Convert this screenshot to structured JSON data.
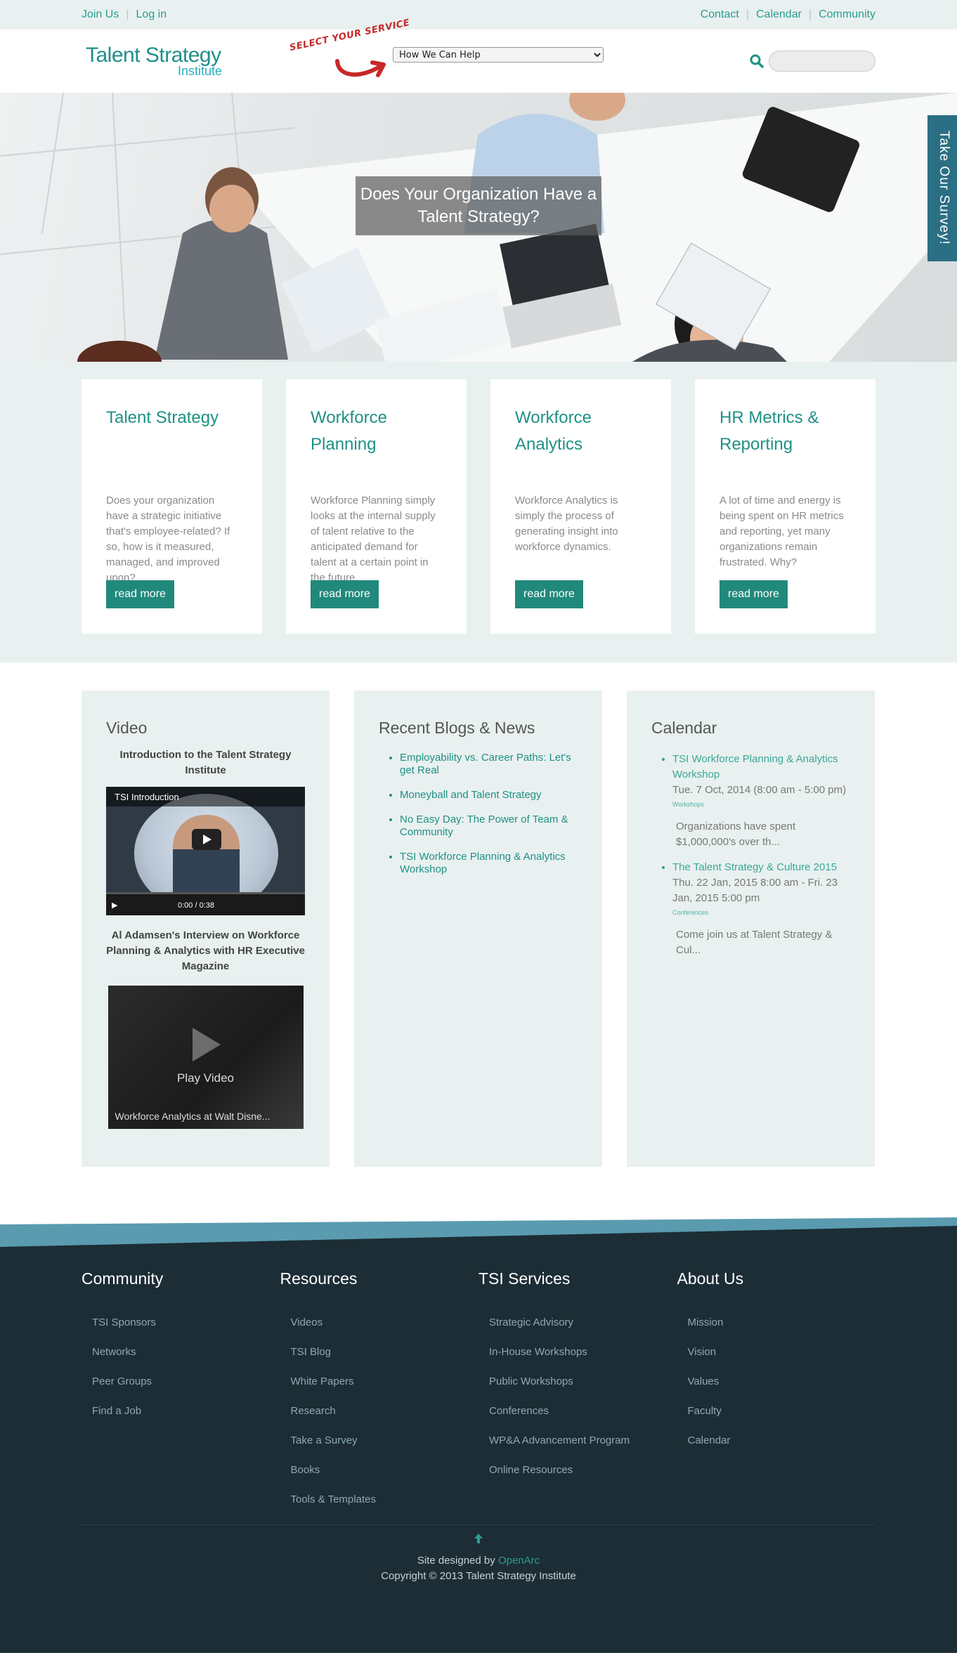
{
  "topbar": {
    "left_links": [
      "Join Us",
      "Log in"
    ],
    "right_links": [
      "Contact",
      "Calendar",
      "Community"
    ]
  },
  "header": {
    "logo_line1": "Talent Strategy",
    "logo_line2": "Institute",
    "select_service_label": "SELECT YOUR SERVICE",
    "service_select_value": "How We Can Help",
    "search_placeholder": ""
  },
  "hero": {
    "caption": "Does Your Organization Have a Talent Strategy?",
    "survey_tab": "Take Our Survey!"
  },
  "services": [
    {
      "title": "Talent Strategy",
      "text": "Does your organization have a strategic initiative that's employee-related?  If so, how is it measured, managed, and improved upon?",
      "button": "read more"
    },
    {
      "title": "Workforce Planning",
      "text": "Workforce Planning simply looks at the internal supply of talent relative to the anticipated demand for talent at a certain point in the future.",
      "button": "read more"
    },
    {
      "title": "Workforce Analytics",
      "text": "Workforce Analytics is simply the process of generating insight into workforce dynamics.",
      "button": "read more"
    },
    {
      "title": "HR Metrics & Reporting",
      "text": "A lot of time and energy is being spent on HR metrics and reporting, yet many organizations remain frustrated. Why?",
      "button": "read more"
    }
  ],
  "video": {
    "heading": "Video",
    "video1_title": "Introduction to the Talent Strategy Institute",
    "video1_bar": "TSI Introduction",
    "video1_time": "0:00 / 0:38",
    "video2_title": "Al Adamsen's Interview on Workforce Planning & Analytics with HR Executive Magazine",
    "video2_play": "Play Video",
    "video2_caption": "Workforce Analytics at Walt Disne..."
  },
  "blogs": {
    "heading": "Recent Blogs & News",
    "items": [
      "Employability vs. Career Paths: Let's get Real",
      "Moneyball and Talent Strategy",
      "No Easy Day: The Power of Team & Community",
      "TSI Workforce Planning & Analytics Workshop"
    ]
  },
  "calendar": {
    "heading": "Calendar",
    "events": [
      {
        "title": "TSI Workforce Planning & Analytics Workshop",
        "when": "Tue. 7 Oct, 2014 (8:00 am - 5:00 pm)",
        "tag": "Workshops",
        "excerpt": "Organizations have spent $1,000,000's over th..."
      },
      {
        "title": "The Talent Strategy & Culture 2015",
        "when": "Thu. 22 Jan, 2015 8:00 am - Fri. 23 Jan, 2015 5:00 pm",
        "tag": "Conferences",
        "excerpt": "Come join us at  Talent Strategy & Cul..."
      }
    ]
  },
  "footer": {
    "columns": [
      {
        "title": "Community",
        "links": [
          "TSI Sponsors",
          "Networks",
          "Peer Groups",
          "Find a Job"
        ]
      },
      {
        "title": "Resources",
        "links": [
          "Videos",
          "TSI Blog",
          "White Papers",
          "Research",
          "Take a Survey",
          "Books",
          "Tools & Templates"
        ]
      },
      {
        "title": "TSI Services",
        "links": [
          "Strategic Advisory",
          "In-House Workshops",
          "Public Workshops",
          "Conferences",
          "WP&A Advancement Program",
          "Online Resources"
        ]
      },
      {
        "title": "About Us",
        "links": [
          "Mission",
          "Vision",
          "Values",
          "Faculty",
          "Calendar"
        ]
      }
    ],
    "designed_by": "Site designed by",
    "designer": "OpenArc",
    "copyright": "Copyright © 2013 Talent Strategy Institute"
  },
  "colors": {
    "accent": "#21897c",
    "footer_bg": "#1c2d35",
    "survey_tab": "#2b6f84",
    "panel_bg": "#e9f0f0"
  }
}
